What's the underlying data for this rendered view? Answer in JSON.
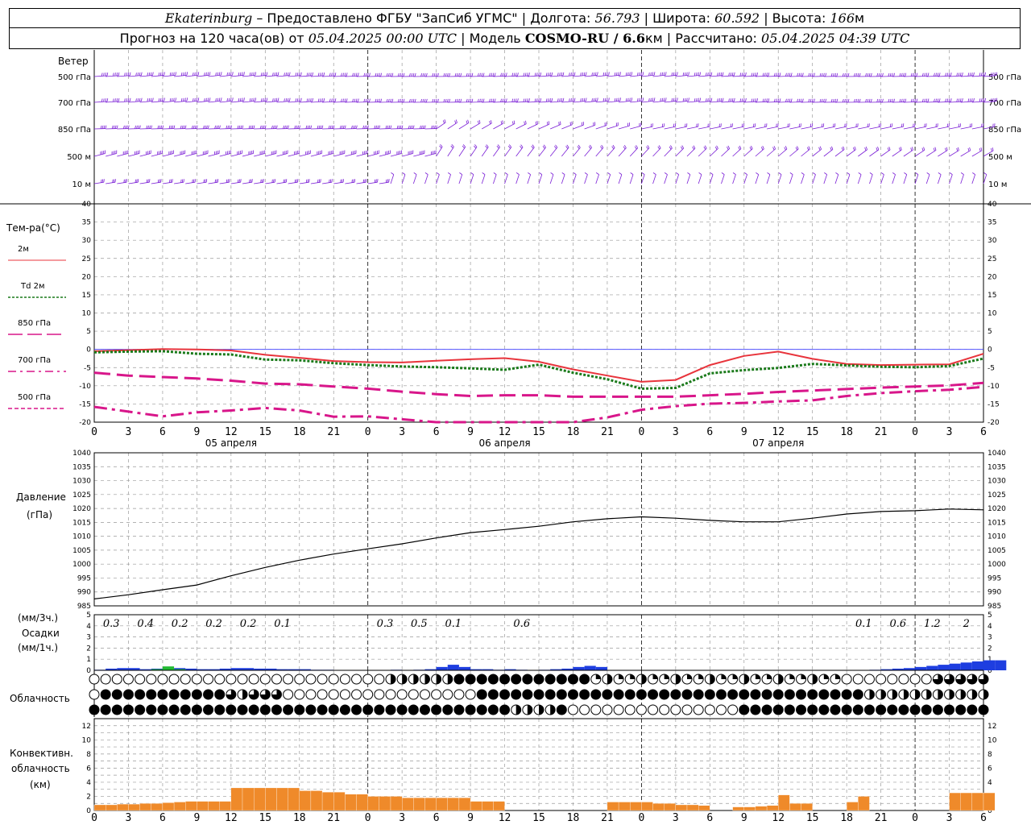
{
  "header": {
    "city": "Ekaterinburg",
    "provider": " – Предоставлено ФГБУ \"ЗапСиб УГМС\"",
    "lon_label": " | Долгота: ",
    "lon": "56.793",
    "lat_label": " | Широта: ",
    "lat": "60.592",
    "alt_label": " | Высота: ",
    "alt": "166",
    "alt_unit": "м",
    "forecast_label": "Прогноз на 120 часа(ов)  от ",
    "forecast_start": "05.04.2025 00:00 UTC",
    "model_label": "  | Модель ",
    "model": "COSMO-RU / 6.6",
    "model_unit": "км",
    "calc_label": " | Рассчитано: ",
    "calc_time": "05.04.2025 04:39 UTC"
  },
  "panels": {
    "wind": {
      "title": "Ветер",
      "levels": [
        "500 гПа",
        "700 гПа",
        "850 гПа",
        "500 м",
        "10   м"
      ],
      "color": "#7b1fd6"
    },
    "temp": {
      "title": "Тем-ра(°C)",
      "legend": [
        "2м",
        "Td  2м",
        "850 гПа",
        "700 гПа",
        "500 гПа"
      ],
      "yticks": [
        "40",
        "35",
        "30",
        "25",
        "20",
        "15",
        "10",
        "5",
        "0",
        "-5",
        "-10",
        "-15",
        "-20"
      ]
    },
    "pressure": {
      "title": "Давление",
      "unit": "(гПа)",
      "yticks": [
        "1040",
        "1035",
        "1030",
        "1025",
        "1020",
        "1015",
        "1010",
        "1005",
        "1000",
        "995",
        "990",
        "985"
      ]
    },
    "precip": {
      "unit3": "(мм/3ч.)",
      "title": "Осадки",
      "unit1": "(мм/1ч.)",
      "yticks": [
        "5",
        "4",
        "3",
        "2",
        "1",
        "0"
      ]
    },
    "cloud": {
      "title": "Облачность"
    },
    "conv": {
      "title1": "Конвективн.",
      "title2": "облачность",
      "unit": "(км)",
      "yticks": [
        "12",
        "10",
        "8",
        "6",
        "4",
        "2",
        "0"
      ]
    }
  },
  "xaxis": {
    "ticks": [
      "0",
      "3",
      "6",
      "9",
      "12",
      "15",
      "18",
      "21",
      "0",
      "3",
      "6",
      "9",
      "12",
      "15",
      "18",
      "21",
      "0",
      "3",
      "6",
      "9",
      "12",
      "15",
      "18",
      "21",
      "0",
      "3",
      "6"
    ],
    "dates": [
      "05 апреля",
      "06 апреля",
      "07 апреля"
    ]
  },
  "chart_data": [
    {
      "type": "line",
      "title": "Тем-ра(°C)",
      "x_hours": [
        0,
        3,
        6,
        9,
        12,
        15,
        18,
        21,
        24,
        27,
        30,
        33,
        36,
        39,
        42,
        45,
        48,
        51,
        54,
        57,
        60,
        63,
        66,
        69,
        72,
        75,
        78
      ],
      "ylim": [
        -20,
        40
      ],
      "series": [
        {
          "name": "2м",
          "color": "#e8343c",
          "values": [
            -0.5,
            -0.2,
            0.1,
            0,
            -0.3,
            -1.5,
            -2.3,
            -3.2,
            -3.5,
            -3.6,
            -3.1,
            -2.7,
            -2.4,
            -3.4,
            -5.5,
            -7.2,
            -8.9,
            -8.4,
            -4.3,
            -1.8,
            -0.6,
            -2.6,
            -4,
            -4.3,
            -4.2,
            -4.1,
            -1.2
          ]
        },
        {
          "name": "Td  2м",
          "color": "#1a7a1a",
          "values": [
            -0.8,
            -0.6,
            -0.5,
            -1.2,
            -1.4,
            -2.8,
            -3,
            -3.8,
            -4.3,
            -4.7,
            -4.9,
            -5.2,
            -5.6,
            -4.2,
            -6.4,
            -8.2,
            -10.8,
            -10.6,
            -6.6,
            -5.7,
            -5.1,
            -4,
            -4.4,
            -4.8,
            -4.9,
            -4.6,
            -2.5
          ]
        },
        {
          "name": "850 гПа",
          "color": "#d8168a",
          "values": [
            -6.4,
            -7.2,
            -7.6,
            -8,
            -8.6,
            -9.4,
            -9.6,
            -10.2,
            -10.8,
            -11.6,
            -12.3,
            -12.8,
            -12.6,
            -12.6,
            -13,
            -13,
            -13,
            -13,
            -12.6,
            -12.2,
            -11.7,
            -11.3,
            -10.9,
            -10.5,
            -10.2,
            -9.9,
            -9.2
          ]
        },
        {
          "name": "700 гПа",
          "color": "#d8168a",
          "values": [
            -15.8,
            -17.1,
            -18.4,
            -17.3,
            -16.8,
            -16.1,
            -16.8,
            -18.5,
            -18.4,
            -19.2,
            -20.2,
            -21.3,
            -21.8,
            -22,
            -20.3,
            -18.7,
            -16.6,
            -15.6,
            -14.9,
            -14.7,
            -14.3,
            -14,
            -12.8,
            -12,
            -11.5,
            -11.1,
            -10.3
          ]
        }
      ]
    },
    {
      "type": "line",
      "title": "Давление",
      "ylabel": "(гПа)",
      "x_hours": [
        0,
        3,
        6,
        9,
        12,
        15,
        18,
        21,
        24,
        27,
        30,
        33,
        36,
        39,
        42,
        45,
        48,
        51,
        54,
        57,
        60,
        63,
        66,
        69,
        72,
        75,
        78
      ],
      "ylim": [
        985,
        1040
      ],
      "series": [
        {
          "name": "Давление",
          "color": "#000000",
          "values": [
            987.5,
            989,
            990.8,
            992.5,
            995.8,
            998.8,
            1001.4,
            1003.6,
            1005.5,
            1007.3,
            1009.4,
            1011.3,
            1012.4,
            1013.6,
            1015.2,
            1016.3,
            1017,
            1016.5,
            1015.7,
            1015.2,
            1015.2,
            1016.5,
            1018,
            1018.9,
            1019.2,
            1019.8,
            1019.5
          ]
        }
      ]
    },
    {
      "type": "bar",
      "title": "Осадки",
      "ylabel": "(мм/1ч.)",
      "ylim": [
        0,
        5
      ],
      "accumulations_3h": [
        {
          "hour": 1.5,
          "label": "0.3"
        },
        {
          "hour": 4.5,
          "label": "0.4"
        },
        {
          "hour": 7.5,
          "label": "0.2"
        },
        {
          "hour": 10.5,
          "label": "0.2"
        },
        {
          "hour": 13.5,
          "label": "0.2"
        },
        {
          "hour": 16.5,
          "label": "0.1"
        },
        {
          "hour": 25.5,
          "label": "0.3"
        },
        {
          "hour": 28.5,
          "label": "0.5"
        },
        {
          "hour": 31.5,
          "label": "0.1"
        },
        {
          "hour": 37.5,
          "label": "0.6"
        },
        {
          "hour": 67.5,
          "label": "0.1"
        },
        {
          "hour": 70.5,
          "label": "0.6"
        },
        {
          "hour": 73.5,
          "label": "1.2"
        },
        {
          "hour": 76.5,
          "label": "2"
        }
      ],
      "hourly_blue": [
        0.05,
        0.15,
        0.2,
        0.2,
        0.1,
        0.15,
        0.15,
        0.2,
        0.15,
        0.1,
        0.1,
        0.15,
        0.2,
        0.2,
        0.15,
        0.15,
        0.1,
        0.1,
        0.1,
        0.05,
        0.05,
        0,
        0,
        0,
        0,
        0,
        0.05,
        0,
        0.05,
        0.1,
        0.3,
        0.5,
        0.3,
        0.1,
        0.1,
        0.05,
        0.1,
        0.05,
        0,
        0.05,
        0.1,
        0.15,
        0.3,
        0.4,
        0.3,
        0,
        0,
        0,
        0,
        0,
        0,
        0,
        0,
        0,
        0,
        0,
        0,
        0,
        0,
        0,
        0,
        0,
        0,
        0,
        0,
        0,
        0,
        0,
        0.05,
        0.1,
        0.15,
        0.2,
        0.3,
        0.4,
        0.5,
        0.6,
        0.7,
        0.8,
        0.9,
        0.9
      ],
      "hourly_green": [
        0,
        0,
        0,
        0,
        0,
        0.1,
        0.35,
        0.1,
        0,
        0,
        0,
        0,
        0,
        0,
        0,
        0,
        0,
        0,
        0,
        0,
        0,
        0,
        0,
        0,
        0,
        0,
        0,
        0,
        0,
        0,
        0,
        0,
        0,
        0,
        0,
        0,
        0,
        0,
        0,
        0,
        0,
        0,
        0,
        0,
        0,
        0,
        0,
        0,
        0,
        0,
        0,
        0,
        0,
        0,
        0,
        0,
        0,
        0,
        0,
        0,
        0,
        0,
        0,
        0,
        0,
        0,
        0,
        0,
        0,
        0,
        0,
        0,
        0,
        0,
        0,
        0,
        0,
        0,
        0
      ]
    },
    {
      "type": "bar",
      "title": "Конвективн. облачность",
      "ylabel": "(км)",
      "ylim": [
        0,
        13
      ],
      "hourly": [
        0.8,
        0.8,
        0.9,
        0.9,
        1,
        1,
        1.1,
        1.2,
        1.3,
        1.3,
        1.3,
        1.3,
        3.2,
        3.2,
        3.2,
        3.2,
        3.2,
        3.2,
        2.8,
        2.8,
        2.6,
        2.6,
        2.3,
        2.3,
        2,
        2,
        2,
        1.8,
        1.8,
        1.8,
        1.8,
        1.8,
        1.8,
        1.3,
        1.3,
        1.3,
        0,
        0,
        0,
        0,
        0,
        0,
        0,
        0,
        0,
        1.2,
        1.2,
        1.2,
        1.2,
        1,
        1,
        0.8,
        0.8,
        0.7,
        0,
        0,
        0.5,
        0.5,
        0.6,
        0.7,
        2.2,
        1,
        1,
        0,
        0,
        0,
        1.2,
        2,
        0,
        0,
        0,
        0,
        0,
        0,
        0,
        2.5,
        2.5,
        2.5,
        2.5,
        2.5,
        2.5,
        2.5,
        2.5,
        2.5,
        2.5
      ],
      "note": "hours 0..78"
    }
  ]
}
